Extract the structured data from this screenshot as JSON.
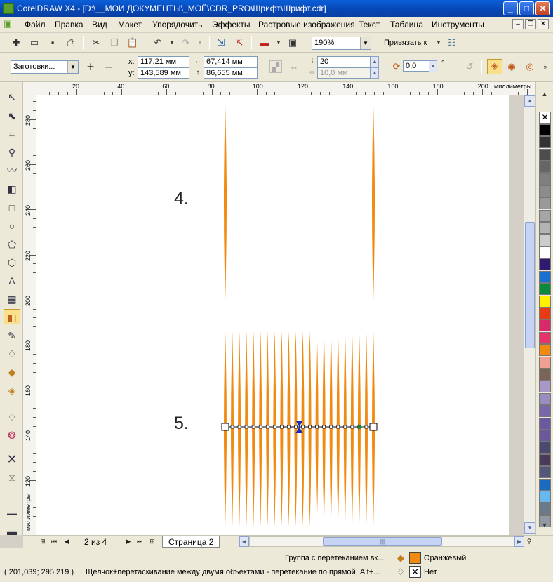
{
  "window": {
    "title": "CorelDRAW X4 - [D:\\__МОИ ДОКУМЕНТЫ\\_МОЁ\\CDR_PRO\\Шрифт\\Шрифт.cdr]",
    "minimize": "_",
    "maximize": "□",
    "close": "✕"
  },
  "menu": {
    "items": [
      "Файл",
      "Правка",
      "Вид",
      "Макет",
      "Упорядочить",
      "Эффекты",
      "Растровые изображения",
      "Текст",
      "Таблица",
      "Инструменты"
    ]
  },
  "standard_toolbar": {
    "zoom": "190%",
    "snap_label": "Привязать к"
  },
  "property_bar": {
    "preset": "Заготовки...",
    "x_label": "x:",
    "x_value": "117,21 мм",
    "y_label": "y:",
    "y_value": "143,589 мм",
    "width": "67,414 мм",
    "height": "86,655 мм",
    "steps": "20",
    "spacing": "10,0 мм",
    "rotation": "0,0",
    "degree": "°"
  },
  "rulers": {
    "unit": "миллиметры",
    "h_ticks": [
      "20",
      "40",
      "60",
      "80",
      "100",
      "120",
      "140",
      "160",
      "180",
      "200"
    ],
    "v_ticks": [
      "280",
      "260",
      "240",
      "220",
      "200",
      "180",
      "160",
      "140",
      "120"
    ],
    "v_unit": "миллиметры"
  },
  "canvas": {
    "label_4": "4.",
    "label_5": "5.",
    "blend_color": "#f08a10",
    "blend_steps": 20
  },
  "page_nav": {
    "page_count": "2 из 4",
    "page_tab": "Страница 2"
  },
  "palette": {
    "colors": [
      "#000000",
      "#333333",
      "#4d4d4d",
      "#666666",
      "#7f7f7f",
      "#8c8c8c",
      "#999999",
      "#a6a6a6",
      "#b3b3b3",
      "#cccccc",
      "#ffffff",
      "#2e1a6e",
      "#1a6fd2",
      "#0a8a3a",
      "#fff000",
      "#e83a14",
      "#d82a6a",
      "#e6336a",
      "#f08a10",
      "#f0a090",
      "#7a6458",
      "#a898c8",
      "#9a8ec0",
      "#7868a8",
      "#6a58a0",
      "#6a5898",
      "#4a4a70",
      "#4a3a5a",
      "#54567a",
      "#1a6ac0",
      "#68b8f0",
      "#6a7a8a",
      "#909aa0"
    ]
  },
  "status": {
    "object_info": "Группа с перетеканием вк...",
    "fill_name": "Оранжевый",
    "fill_color": "#f08a10",
    "outline_name": "Нет",
    "coords": "( 201,039; 295,219 )",
    "hint": "Щелчок+перетаскивание между двумя объектами - перетекание по прямой, Alt+..."
  }
}
